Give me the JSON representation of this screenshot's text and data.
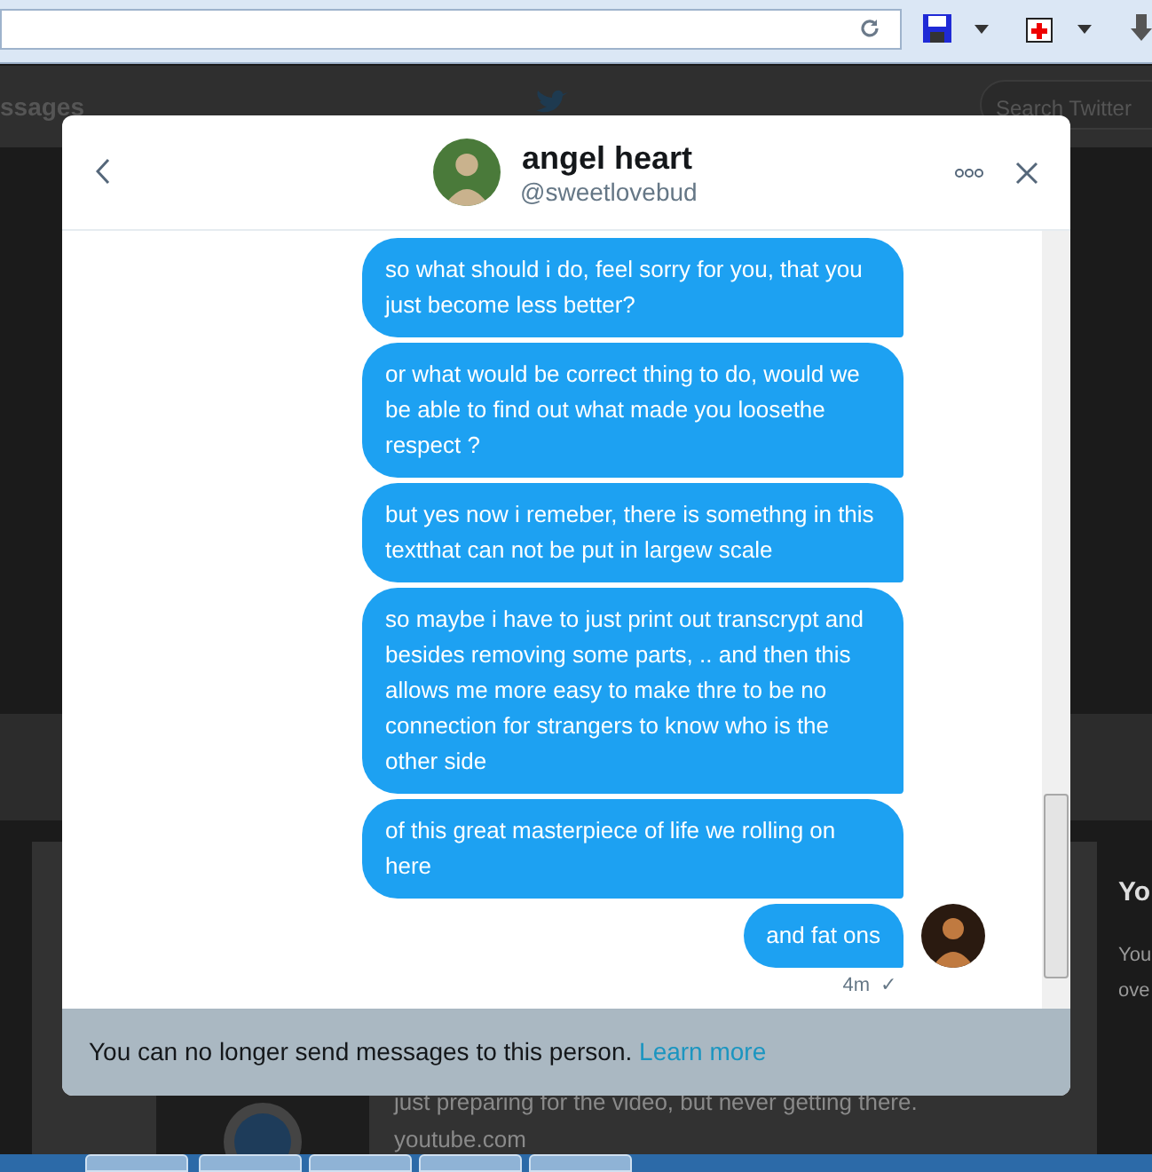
{
  "background_page": {
    "nav_label": "ssages",
    "search_placeholder": "Search Twitter",
    "side_heading": "Yo",
    "side_lines": [
      "You",
      "ove"
    ],
    "card_text": "just preparing for the video, but never getting there.",
    "card_link": "youtube.com"
  },
  "dialog": {
    "name": "angel heart",
    "handle": "@sweetlovebud",
    "messages": [
      {
        "text": "so what should i do, feel sorry for you, that you just become less better?"
      },
      {
        "text": "or what would be correct thing to do, would we be able to find out what made you loosethe respect ?"
      },
      {
        "text": "but yes now i remeber, there is somethng in this textthat can not be put in largew scale"
      },
      {
        "text": "so maybe i have to just print out transcrypt and besides removing some parts, .. and then this allows me more easy to make thre to be no connection for strangers to know who is the other side"
      },
      {
        "text": "of this great masterpiece of life we rolling on here"
      },
      {
        "text": "and fat ons",
        "time": "4m",
        "status": "✓",
        "avatar": true
      }
    ],
    "notice": "You can no longer send messages to this person.",
    "notice_link": "Learn more"
  }
}
